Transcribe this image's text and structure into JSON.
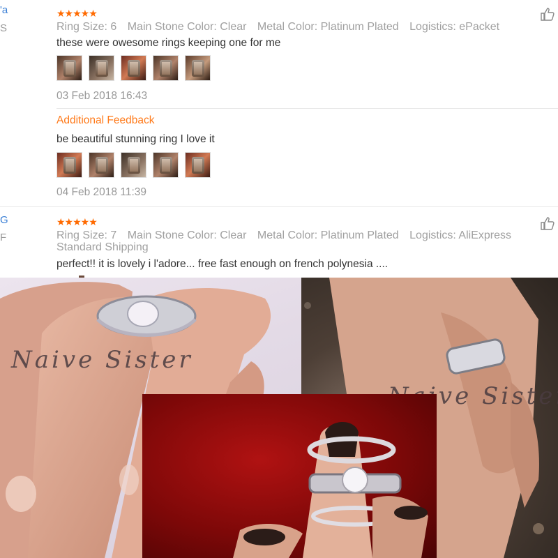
{
  "reviews": [
    {
      "name_fragment": "'a",
      "country_fragment": "S",
      "stars": "★★★★★",
      "attributes": [
        "Ring Size: 6",
        "Main Stone Color: Clear",
        "Metal Color: Platinum Plated",
        "Logistics: ePacket"
      ],
      "text": "these were owesome rings keeping one for me",
      "thumbnail_count": 5,
      "date": "03 Feb 2018 16:43",
      "additional_label": "Additional Feedback",
      "additional_text": "be beautiful stunning ring I love it",
      "additional_date": "04 Feb 2018 11:39"
    },
    {
      "name_fragment": "G",
      "country_fragment": "F",
      "stars": "★★★★★",
      "attributes_line1": [
        "Ring Size: 7",
        "Main Stone Color: Clear",
        "Metal Color: Platinum Plated",
        "Logistics: AliExpress"
      ],
      "attributes_line2": "Standard Shipping",
      "text": "perfect!! it is lovely i l'adore... free fast enough on french polynesia ...."
    }
  ],
  "icons": {
    "helpful": "thumbs-up-icon"
  },
  "colors": {
    "stars": "#ff6a00",
    "additional": "#ff7a1a",
    "name_link": "#3a7fd5"
  },
  "photos": {
    "watermark_left": "Naive Sister",
    "watermark_right": "Naive Sister"
  }
}
